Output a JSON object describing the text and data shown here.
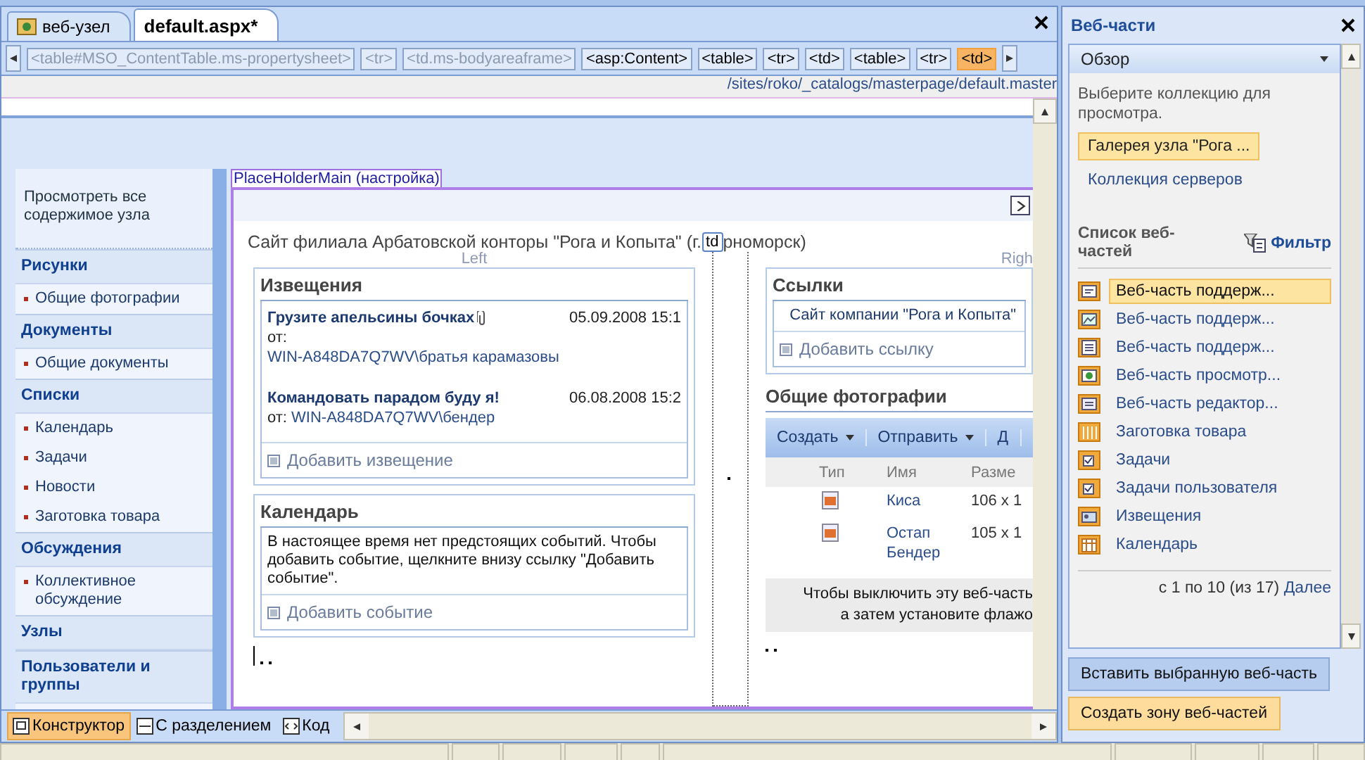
{
  "doc_tabs": [
    {
      "label": "веб-узел",
      "selected": false,
      "kind": "site"
    },
    {
      "label": "default.aspx*",
      "selected": true,
      "kind": "page"
    }
  ],
  "tag_bar": [
    {
      "label": "<table#MSO_ContentTable.ms-propertysheet>",
      "dim": true,
      "selected": false
    },
    {
      "label": "<tr>",
      "dim": true,
      "selected": false
    },
    {
      "label": "<td.ms-bodyareaframe>",
      "dim": true,
      "selected": false
    },
    {
      "label": "<asp:Content>",
      "dim": false,
      "selected": false
    },
    {
      "label": "<table>",
      "dim": false,
      "selected": false
    },
    {
      "label": "<tr>",
      "dim": false,
      "selected": false
    },
    {
      "label": "<td>",
      "dim": false,
      "selected": false
    },
    {
      "label": "<table>",
      "dim": false,
      "selected": false
    },
    {
      "label": "<tr>",
      "dim": false,
      "selected": false
    },
    {
      "label": "<td>",
      "dim": false,
      "selected": true
    }
  ],
  "master_path": "/sites/roko/_catalogs/masterpage/default.master",
  "nav": {
    "view_all": "Просмотреть все содержимое узла",
    "groups": [
      {
        "title": "Рисунки",
        "items": [
          "Общие фотографии"
        ]
      },
      {
        "title": "Документы",
        "items": [
          "Общие документы"
        ]
      },
      {
        "title": "Списки",
        "items": [
          "Календарь",
          "Задачи",
          "Новости",
          "Заготовка товара"
        ]
      },
      {
        "title": "Обсуждения",
        "items": [
          "Коллективное обсуждение"
        ]
      },
      {
        "title": "Узлы"
      },
      {
        "title": "Пользователи и группы"
      }
    ]
  },
  "placeholder_label": "PlaceHolderMain (настройка)",
  "site_title_start": "Сайт филиала Арбатовской конторы \"Рога и Копыта\" (г.",
  "cell_tag": "td",
  "site_title_end": "рноморск)",
  "zone_left": "Left",
  "zone_right": "Righ",
  "announcements": {
    "title": "Извещения",
    "items": [
      {
        "title": "Грузите апельсины бочках",
        "attachment": true,
        "date": "05.09.2008 15:1",
        "from": "от:",
        "author": "WIN-A848DA7Q7WV\\братья карамазовы",
        "author_wrapped": true
      },
      {
        "title": "Командовать парадом буду я!",
        "attachment": false,
        "date": "06.08.2008 15:2",
        "from": "от:",
        "author": "WIN-A848DA7Q7WV\\бендер",
        "author_wrapped": false
      }
    ],
    "add": "Добавить извещение"
  },
  "calendar": {
    "title": "Календарь",
    "message": "В настоящее время нет предстоящих событий. Чтобы добавить событие, щелкните внизу ссылку \"Добавить событие\".",
    "add": "Добавить событие"
  },
  "links": {
    "title": "Ссылки",
    "items": [
      "Сайт компании \"Рога и Копыта\""
    ],
    "add": "Добавить ссылку"
  },
  "photos": {
    "title": "Общие фотографии",
    "toolbar": [
      "Создать",
      "Отправить",
      "Д"
    ],
    "columns": [
      "Тип",
      "Имя",
      "Разме"
    ],
    "rows": [
      {
        "name": "Киса",
        "size": "106 x 1"
      },
      {
        "name": "Остап Бендер",
        "size": "105 x 1"
      }
    ],
    "notice": [
      "Чтобы выключить эту веб-часть",
      "а затем установите флажо"
    ]
  },
  "view_tabs": [
    {
      "label": "Конструктор",
      "selected": true,
      "kind": "design"
    },
    {
      "label": "С разделением",
      "selected": false,
      "kind": "split"
    },
    {
      "label": "Код",
      "selected": false,
      "kind": "code"
    }
  ],
  "panel": {
    "title": "Веб-части",
    "mode": "Обзор",
    "hint": "Выберите коллекцию для просмотра.",
    "collections": [
      {
        "label": "Галерея узла \"Рога ...",
        "selected": true
      },
      {
        "label": "Коллекция серверов",
        "selected": false
      }
    ],
    "list_title": "Список веб-частей",
    "filter": "Фильтр",
    "parts": [
      {
        "label": "Веб-часть поддерж...",
        "kind": "form",
        "selected": true
      },
      {
        "label": "Веб-часть поддерж...",
        "kind": "image",
        "selected": false
      },
      {
        "label": "Веб-часть поддерж...",
        "kind": "list",
        "selected": false
      },
      {
        "label": "Веб-часть просмотр...",
        "kind": "viewer",
        "selected": false
      },
      {
        "label": "Веб-часть редактор...",
        "kind": "editor",
        "selected": false
      },
      {
        "label": "Заготовка товара",
        "kind": "columns",
        "selected": false
      },
      {
        "label": "Задачи",
        "kind": "tasks",
        "selected": false
      },
      {
        "label": "Задачи пользователя",
        "kind": "tasks",
        "selected": false
      },
      {
        "label": "Извещения",
        "kind": "announce",
        "selected": false
      },
      {
        "label": "Календарь",
        "kind": "calendar",
        "selected": false
      }
    ],
    "pager": "с 1 по 10 (из 17)",
    "next": "Далее",
    "insert_button": "Вставить выбранную веб-часть",
    "zone_button": "Создать зону веб-частей"
  }
}
